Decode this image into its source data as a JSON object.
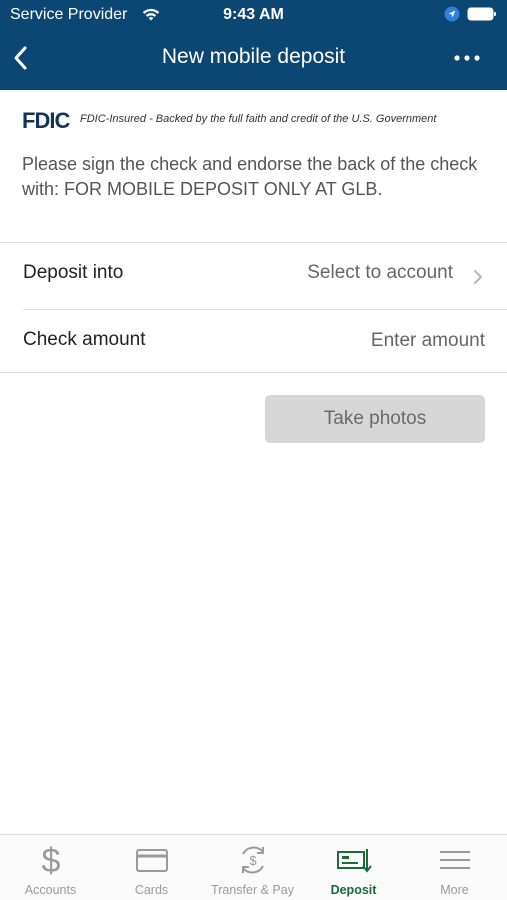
{
  "status_bar": {
    "carrier": "Service Provider",
    "time": "9:43 AM"
  },
  "nav": {
    "title": "New mobile deposit",
    "back_icon": "chevron-left-icon",
    "more_icon": "ellipsis-icon"
  },
  "fdic": {
    "logo": "FDIC",
    "text": "FDIC-Insured - Backed by the full faith and credit of the U.S. Government"
  },
  "instructions": "Please sign the check and endorse the back of the check with: FOR MOBILE DEPOSIT ONLY AT GLB.",
  "form": {
    "deposit_into": {
      "label": "Deposit into",
      "value": "Select to account"
    },
    "check_amount": {
      "label": "Check amount",
      "placeholder": "Enter amount",
      "value": ""
    }
  },
  "take_photos_label": "Take photos",
  "tabs": [
    {
      "label": "Accounts",
      "icon": "dollar-icon",
      "active": false
    },
    {
      "label": "Cards",
      "icon": "card-icon",
      "active": false
    },
    {
      "label": "Transfer & Pay",
      "icon": "transfer-icon",
      "active": false
    },
    {
      "label": "Deposit",
      "icon": "check-deposit-icon",
      "active": true
    },
    {
      "label": "More",
      "icon": "menu-icon",
      "active": false
    }
  ],
  "colors": {
    "header": "#0c4672",
    "active_tab": "#1d6b3a",
    "inactive_tab": "#9a9a9a",
    "button_disabled": "#d6d6d6"
  }
}
